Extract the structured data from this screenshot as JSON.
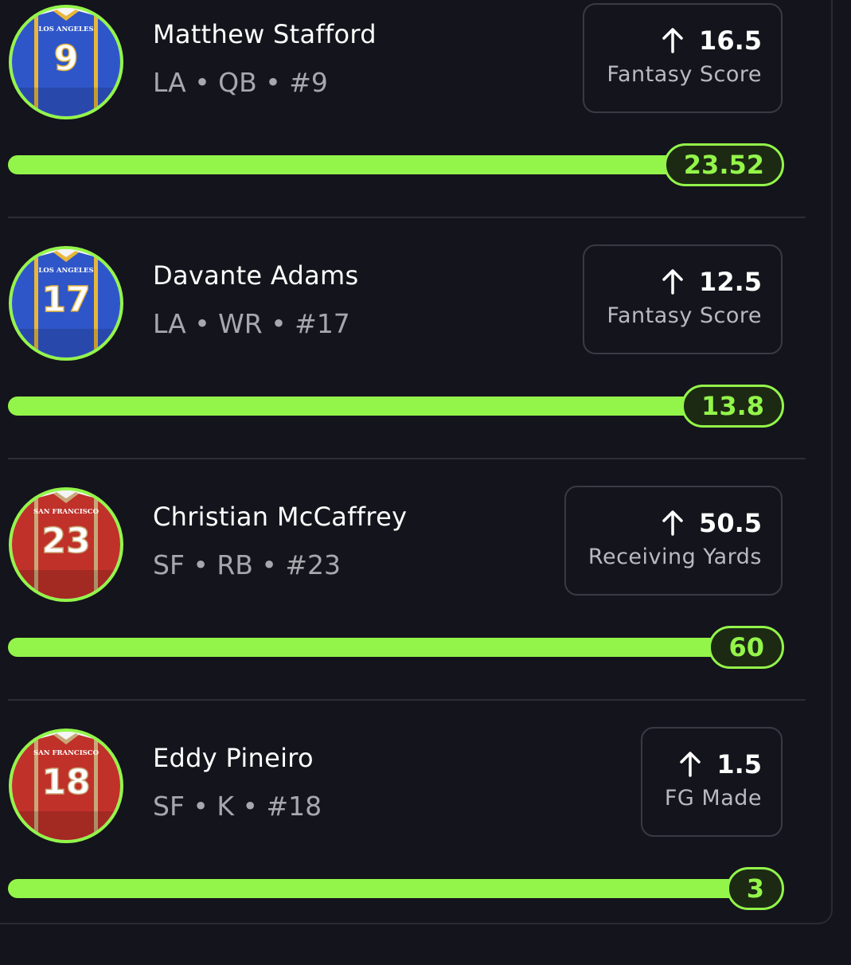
{
  "players": [
    {
      "name": "Matthew Stafford",
      "meta": "LA • QB • #9",
      "jersey_team": "LOS ANGELES",
      "jersey_number": "9",
      "jersey_color": "#2f56c9",
      "jersey_trim": "#e8b73a",
      "projection_value": "16.5",
      "projection_label": "Fantasy Score",
      "actual_value": "23.52",
      "progress_fraction": 1.0,
      "icon": "arrow-up-icon"
    },
    {
      "name": "Davante Adams",
      "meta": "LA • WR • #17",
      "jersey_team": "LOS ANGELES",
      "jersey_number": "17",
      "jersey_color": "#2f56c9",
      "jersey_trim": "#e8b73a",
      "projection_value": "12.5",
      "projection_label": "Fantasy Score",
      "actual_value": "13.8",
      "progress_fraction": 1.0,
      "icon": "arrow-up-icon"
    },
    {
      "name": "Christian McCaffrey",
      "meta": "SF • RB • #23",
      "jersey_team": "SAN FRANCISCO",
      "jersey_number": "23",
      "jersey_color": "#c0312a",
      "jersey_trim": "#c8a878",
      "projection_value": "50.5",
      "projection_label": "Receiving Yards",
      "actual_value": "60",
      "progress_fraction": 1.0,
      "icon": "arrow-up-icon"
    },
    {
      "name": "Eddy Pineiro",
      "meta": "SF • K • #18",
      "jersey_team": "SAN FRANCISCO",
      "jersey_number": "18",
      "jersey_color": "#c0312a",
      "jersey_trim": "#c8a878",
      "projection_value": "1.5",
      "projection_label": "FG Made",
      "actual_value": "3",
      "progress_fraction": 1.0,
      "icon": "arrow-up-icon"
    }
  ],
  "colors": {
    "background": "#14141c",
    "accent_green": "#93f54a",
    "box_border": "#3a3a44",
    "meta_text": "#a7a7ae"
  }
}
